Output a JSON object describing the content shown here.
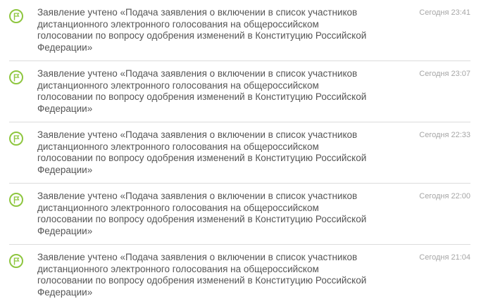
{
  "colors": {
    "accent": "#8ec63f",
    "text": "#555555",
    "time": "#a6a6a6",
    "divider": "#dcdcdc"
  },
  "notifications": [
    {
      "icon": "flag-icon",
      "text": "Заявление учтено «Подача заявления о включении в список участников дистанционного электронного голосования на общероссийском голосовании по вопросу одобрения изменений в Конституцию Российской Федерации»",
      "time": "Сегодня 23:41"
    },
    {
      "icon": "flag-icon",
      "text": "Заявление учтено «Подача заявления о включении в список участников дистанционного электронного голосования на общероссийском голосовании по вопросу одобрения изменений в Конституцию Российской Федерации»",
      "time": "Сегодня 23:07"
    },
    {
      "icon": "flag-icon",
      "text": "Заявление учтено «Подача заявления о включении в список участников дистанционного электронного голосования на общероссийском голосовании по вопросу одобрения изменений в Конституцию Российской Федерации»",
      "time": "Сегодня 22:33"
    },
    {
      "icon": "flag-icon",
      "text": "Заявление учтено «Подача заявления о включении в список участников дистанционного электронного голосования на общероссийском голосовании по вопросу одобрения изменений в Конституцию Российской Федерации»",
      "time": "Сегодня 22:00"
    },
    {
      "icon": "flag-icon",
      "text": "Заявление учтено «Подача заявления о включении в список участников дистанционного электронного голосования на общероссийском голосовании по вопросу одобрения изменений в Конституцию Российской Федерации»",
      "time": "Сегодня 21:04"
    }
  ]
}
